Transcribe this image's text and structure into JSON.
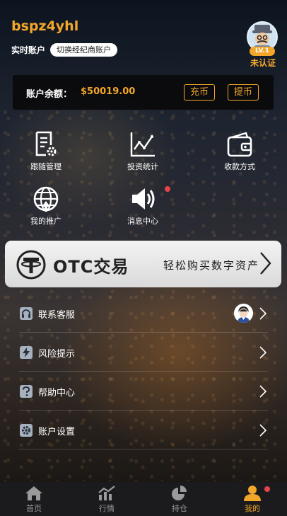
{
  "header": {
    "username": "bspz4yhl",
    "account_type": "实时账户",
    "switch_label": "切换经纪商账户",
    "level": "LV.1",
    "verify_status": "未认证"
  },
  "balance": {
    "label": "账户余额：",
    "value": "$50019.00",
    "deposit_label": "充币",
    "withdraw_label": "提币"
  },
  "menu": [
    {
      "label": "跟随管理",
      "icon": "document-gear-icon"
    },
    {
      "label": "投资统计",
      "icon": "line-chart-icon"
    },
    {
      "label": "收款方式",
      "icon": "wallet-icon"
    },
    {
      "label": "我的推广",
      "icon": "globe-icon"
    },
    {
      "label": "消息中心",
      "icon": "speaker-icon"
    }
  ],
  "otc": {
    "title": "OTC交易",
    "subtitle": "轻松购买数字资产"
  },
  "list": [
    {
      "label": "联系客服",
      "icon": "headset-icon"
    },
    {
      "label": "风险提示",
      "icon": "lightning-icon"
    },
    {
      "label": "帮助中心",
      "icon": "question-icon"
    },
    {
      "label": "账户设置",
      "icon": "gear-icon"
    }
  ],
  "tabs": [
    {
      "label": "首页",
      "icon": "home-icon"
    },
    {
      "label": "行情",
      "icon": "market-chart-icon"
    },
    {
      "label": "持仓",
      "icon": "pie-chart-icon"
    },
    {
      "label": "我的",
      "icon": "user-icon"
    }
  ],
  "colors": {
    "accent": "#f3a72a",
    "badge_red": "#e8434a",
    "tabbar_bg": "#1b1b1d"
  }
}
